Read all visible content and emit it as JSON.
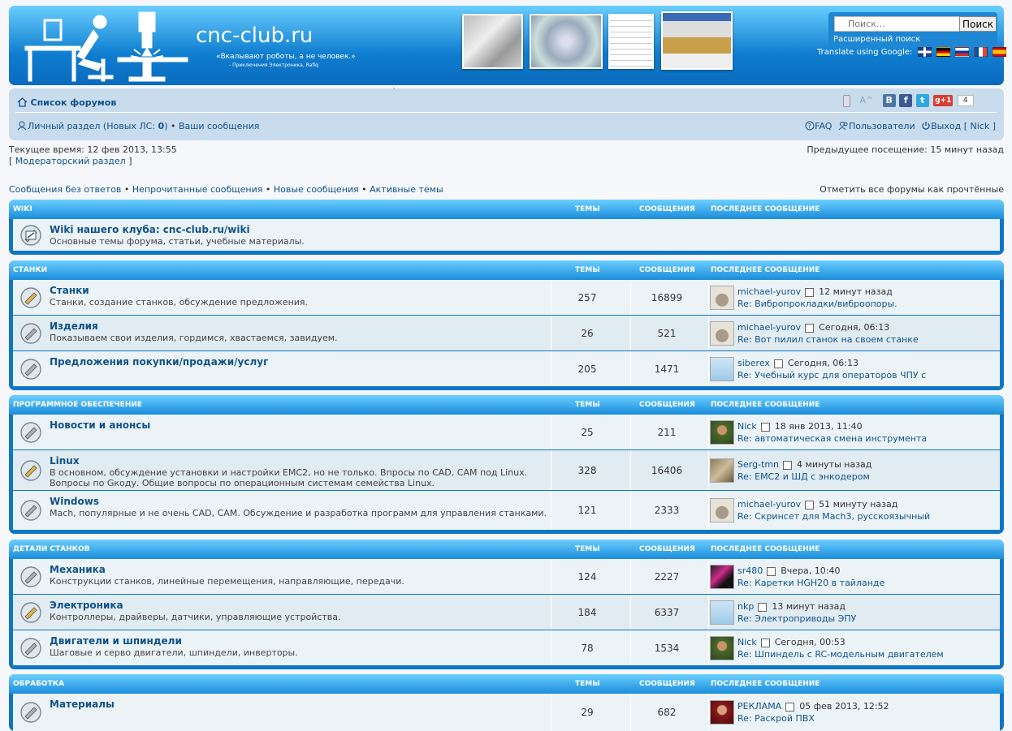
{
  "header": {
    "site_title": "cnc-club.ru",
    "site_desc": "«Вкалывают роботы, а не человек.»",
    "site_desc2": "- Приключения Электроника, Rafiq",
    "search_placeholder": "Поиск…",
    "search_button": "Поиск",
    "advanced_search": "Расширенный поиск",
    "translate": "Translate using Google:",
    "flags": [
      "gb-flag",
      "de-flag",
      "ru-flag",
      "fr-flag",
      "es-flag"
    ]
  },
  "navbar": {
    "forum_index": "Список форумов",
    "text_size": "A^",
    "share_count": "4",
    "social": [
      "В",
      "f",
      "t",
      "g+1"
    ],
    "personal": "Личный раздел",
    "new_pm_prefix": "(Новых ЛС: ",
    "new_pm_count": "0",
    "new_pm_suffix": ")",
    "bullet": "•",
    "your_posts": "Ваши сообщения",
    "faq": "FAQ",
    "users": "Пользователи",
    "logout": "Выход",
    "username": "Nick"
  },
  "info": {
    "current_time": "Текущее время: 12 фев 2013, 13:55",
    "moderator_link": "Модераторский раздел",
    "last_visit": "Предыдущее посещение: 15 минут назад",
    "links": [
      "Сообщения без ответов",
      "Непрочитанные сообщения",
      "Новые сообщения",
      "Активные темы"
    ],
    "mark_read": "Отметить все форумы как прочтённые"
  },
  "columns": {
    "topics": "ТЕМЫ",
    "posts": "СООБЩЕНИЯ",
    "last_post": "ПОСЛЕДНЕЕ СООБЩЕНИЕ"
  },
  "categories": [
    {
      "name": "WIKI",
      "forums": [
        {
          "title": "Wiki нашего клуба: cnc-club.ru/wiki",
          "desc": "Основные темы форума, статьи, учебные материалы.",
          "topics": "",
          "posts": "",
          "user": "",
          "time": "",
          "post": ""
        }
      ]
    },
    {
      "name": "СТАНКИ",
      "forums": [
        {
          "title": "Станки",
          "desc": "Станки, создание станков, обсуждение предложения.",
          "topics": "257",
          "posts": "16899",
          "user": "michael-yurov",
          "time": "12 минут назад",
          "post": "Re: Вибропрокладки/виброопоры."
        },
        {
          "title": "Изделия",
          "desc": "Показываем свои изделия, гордимся, хвастаемся, завидуем.",
          "topics": "26",
          "posts": "521",
          "user": "michael-yurov",
          "time": "Сегодня, 06:13",
          "post": "Re: Вот пилил станок на своем станке"
        },
        {
          "title": "Предложения покупки/продажи/услуг",
          "desc": "",
          "topics": "205",
          "posts": "1471",
          "user": "siberex",
          "time": "Сегодня, 06:13",
          "post": "Re: Учебный курс для операторов ЧПУ с"
        }
      ]
    },
    {
      "name": "ПРОГРАММНОЕ ОБЕСПЕЧЕНИЕ",
      "forums": [
        {
          "title": "Новости и анонсы",
          "desc": "",
          "topics": "25",
          "posts": "211",
          "user": "Nick",
          "time": "18 янв 2013, 11:40",
          "post": "Re: автоматическая смена инструмента"
        },
        {
          "title": "Linux",
          "desc": "В основном, обсуждение установки и настройки EMC2, но не только. Впросы по CAD, CAM под Linux. Вопросы по Gкоду. Общие вопросы по операционным системам семейства Linux.",
          "topics": "328",
          "posts": "16406",
          "user": "Serg-tmn",
          "time": "4 минуты назад",
          "post": "Re: EMC2 и ШД с энкодером"
        },
        {
          "title": "Windows",
          "desc": "Mach, популярные и не очень CAD, CAM. Обсуждение и разработка программ для управления станками.",
          "topics": "121",
          "posts": "2333",
          "user": "michael-yurov",
          "time": "51 минуту назад",
          "post": "Re: Скринсет для Mach3, русскоязычный"
        }
      ]
    },
    {
      "name": "ДЕТАЛИ СТАНКОВ",
      "forums": [
        {
          "title": "Механика",
          "desc": "Конструкции станков, линейные перемещения, направляющие, передачи.",
          "topics": "124",
          "posts": "2227",
          "user": "sr480",
          "time": "Вчера, 10:40",
          "post": "Re: Каретки HGH20 в тайланде"
        },
        {
          "title": "Электроника",
          "desc": "Контроллеры, драйверы, датчики, управляющие устройства.",
          "topics": "184",
          "posts": "6337",
          "user": "nkp",
          "time": "13 минут назад",
          "post": "Re: Электроприводы ЭПУ"
        },
        {
          "title": "Двигатели и шпиндели",
          "desc": "Шаговые и серво двигатели, шпиндели, инверторы.",
          "topics": "78",
          "posts": "1534",
          "user": "Nick",
          "time": "Сегодня, 00:53",
          "post": "Re: Шпиндель с RC-модельным двигателем"
        }
      ]
    },
    {
      "name": "ОБРАБОТКА",
      "forums": [
        {
          "title": "Материалы",
          "desc": "",
          "topics": "29",
          "posts": "682",
          "user": "РЕКЛАМА",
          "time": "05 фев 2013, 12:52",
          "post": "Re: Раскрой ПВХ"
        }
      ]
    }
  ]
}
